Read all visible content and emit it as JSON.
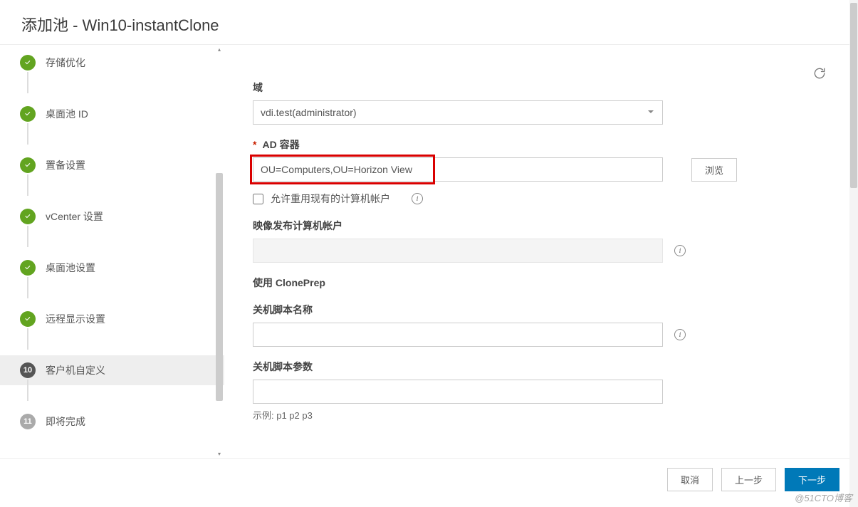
{
  "header": {
    "title": "添加池 - Win10-instantClone"
  },
  "sidebar": {
    "steps": [
      {
        "label": "存储优化",
        "state": "done"
      },
      {
        "label": "桌面池 ID",
        "state": "done"
      },
      {
        "label": "置备设置",
        "state": "done"
      },
      {
        "label": "vCenter 设置",
        "state": "done"
      },
      {
        "label": "桌面池设置",
        "state": "done"
      },
      {
        "label": "远程显示设置",
        "state": "done"
      },
      {
        "label": "客户机自定义",
        "state": "active",
        "num": "10"
      },
      {
        "label": "即将完成",
        "state": "pending",
        "num": "11"
      }
    ]
  },
  "form": {
    "domain_label": "域",
    "domain_value": "vdi.test(administrator)",
    "ad_label": "AD 容器",
    "ad_value": "OU=Computers,OU=Horizon View",
    "browse_label": "浏览",
    "reuse_label": "允许重用现有的计算机帐户",
    "image_account_label": "映像发布计算机帐户",
    "cloneprep_label": "使用 ClonePrep",
    "shutdown_name_label": "关机脚本名称",
    "shutdown_param_label": "关机脚本参数",
    "example": "示例: p1 p2 p3"
  },
  "footer": {
    "cancel": "取消",
    "prev": "上一步",
    "next": "下一步"
  },
  "watermark": "@51CTO博客"
}
